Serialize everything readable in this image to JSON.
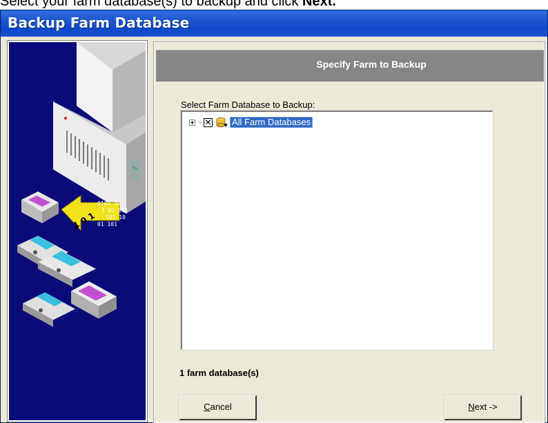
{
  "instruction": {
    "prefix": "Select your farm database(s) to backup and click ",
    "bold": "Next."
  },
  "window": {
    "title": "Backup Farm Database",
    "colors": {
      "title_bar": "#1f58cf",
      "left_panel": "#0a0a78",
      "header_bar": "#868686",
      "selection": "#316ac5"
    }
  },
  "page": {
    "header": "Specify Farm to Backup",
    "select_label": "Select Farm Database to Backup:",
    "tree": {
      "items": [
        {
          "label": "All Farm Databases",
          "checked": true,
          "checkbox_mark": "✕",
          "expanded": false,
          "selected": true,
          "icon": "database-icon"
        }
      ]
    },
    "count": "1 farm database(s)"
  },
  "buttons": {
    "cancel": {
      "accel": "C",
      "rest": "ancel"
    },
    "next": {
      "accel": "N",
      "rest": "ext ->"
    }
  }
}
